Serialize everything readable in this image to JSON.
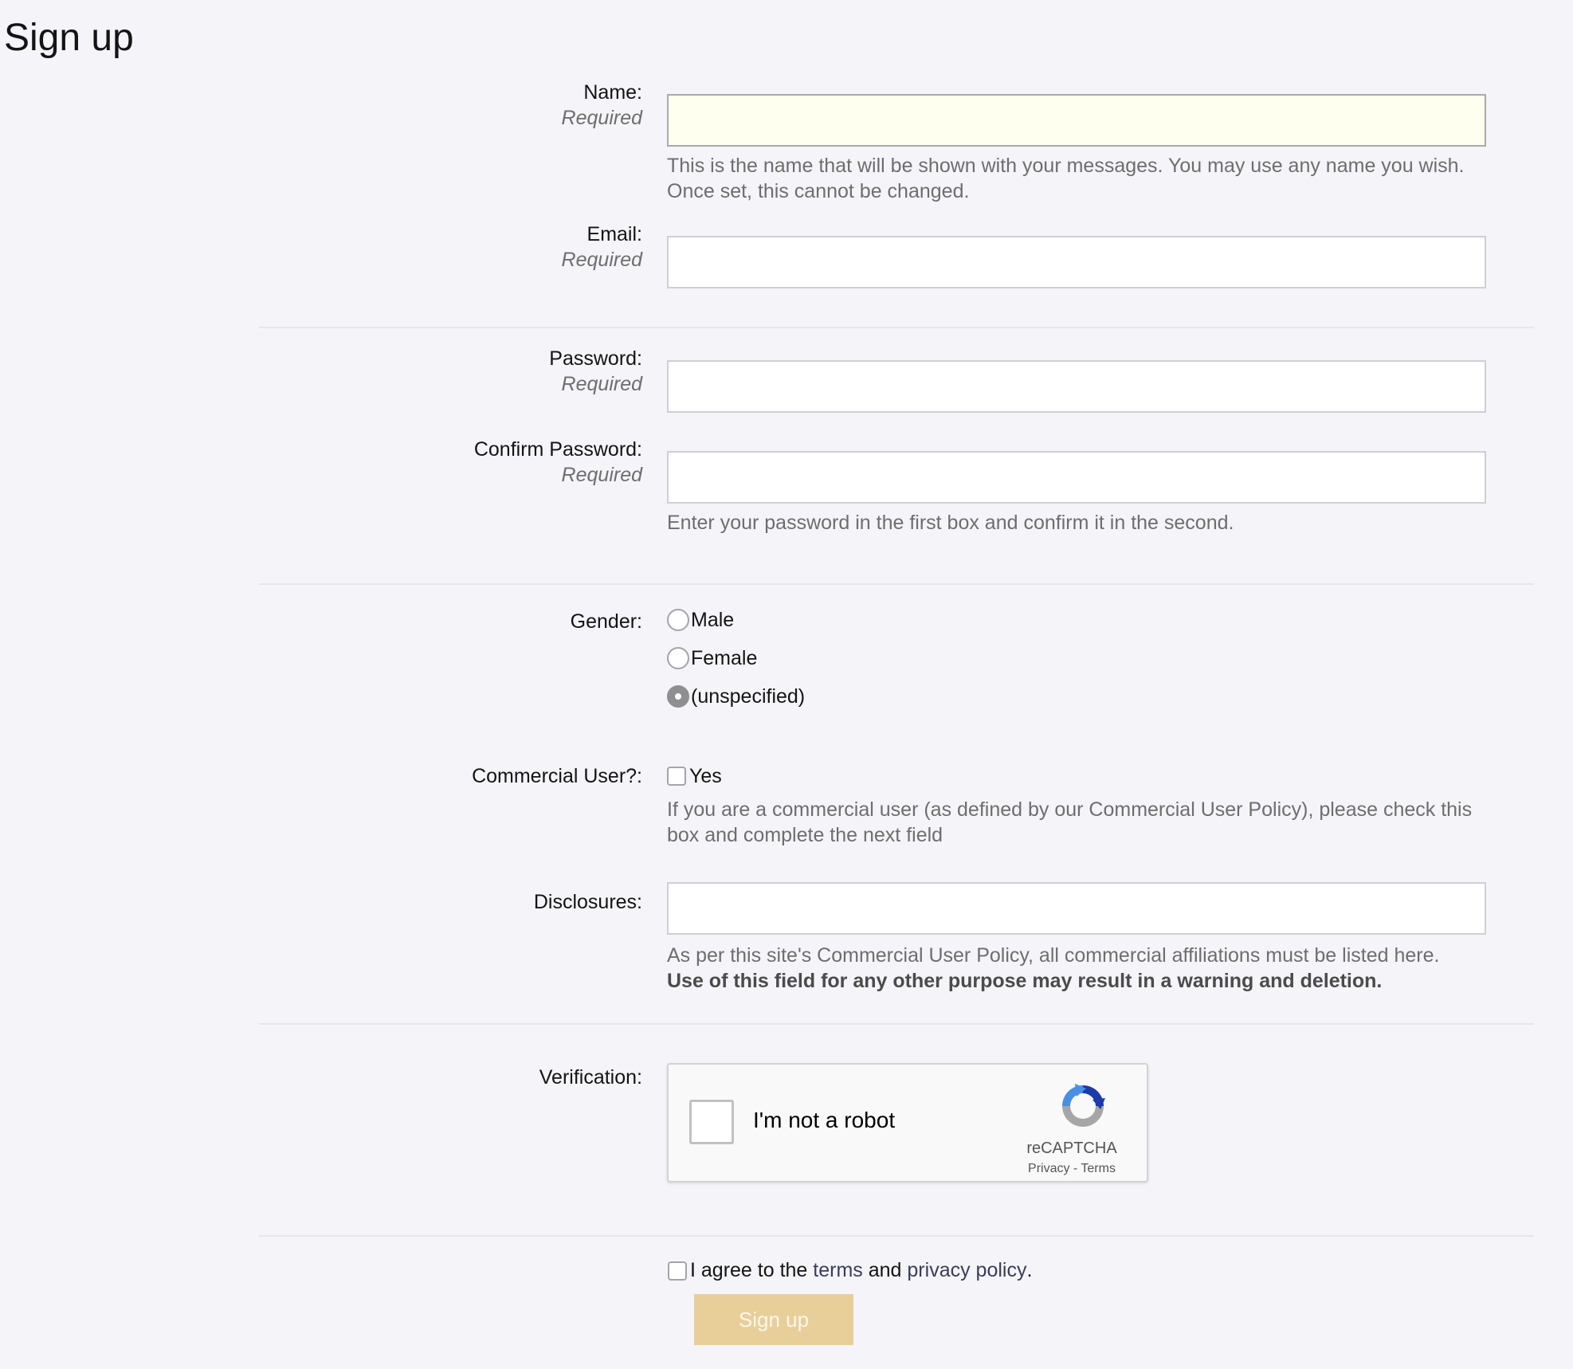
{
  "page": {
    "title": "Sign up"
  },
  "fields": {
    "name": {
      "label": "Name:",
      "required": "Required",
      "value": "",
      "hint": "This is the name that will be shown with your messages. You may use any name you wish. Once set, this cannot be changed."
    },
    "email": {
      "label": "Email:",
      "required": "Required",
      "value": ""
    },
    "password": {
      "label": "Password:",
      "required": "Required",
      "value": ""
    },
    "confirm_password": {
      "label": "Confirm Password:",
      "required": "Required",
      "value": "",
      "hint": "Enter your password in the first box and confirm it in the second."
    },
    "gender": {
      "label": "Gender:",
      "options": [
        "Male",
        "Female",
        "(unspecified)"
      ],
      "selected": "(unspecified)"
    },
    "commercial_user": {
      "label": "Commercial User?:",
      "option": "Yes",
      "checked": false,
      "hint": "If you are a commercial user (as defined by our Commercial User Policy), please check this box and complete the next field"
    },
    "disclosures": {
      "label": "Disclosures:",
      "value": "",
      "hint": "As per this site's Commercial User Policy, all commercial affiliations must be listed here.",
      "hint_bold": "Use of this field for any other purpose may result in a warning and deletion."
    },
    "verification": {
      "label": "Verification:",
      "captcha_label": "I'm not a robot",
      "brand": "reCAPTCHA",
      "privacy": "Privacy",
      "separator": "-",
      "terms": "Terms"
    }
  },
  "agree": {
    "prefix": "I agree to the",
    "terms": "terms",
    "and": "and",
    "privacy": "privacy policy",
    "suffix": ".",
    "checked": false
  },
  "submit": {
    "label": "Sign up"
  },
  "colors": {
    "background": "#f4f4f9",
    "input_highlight": "#fffff0",
    "submit_bg": "#e8cf9a",
    "hint_text": "#6e6e6e"
  }
}
